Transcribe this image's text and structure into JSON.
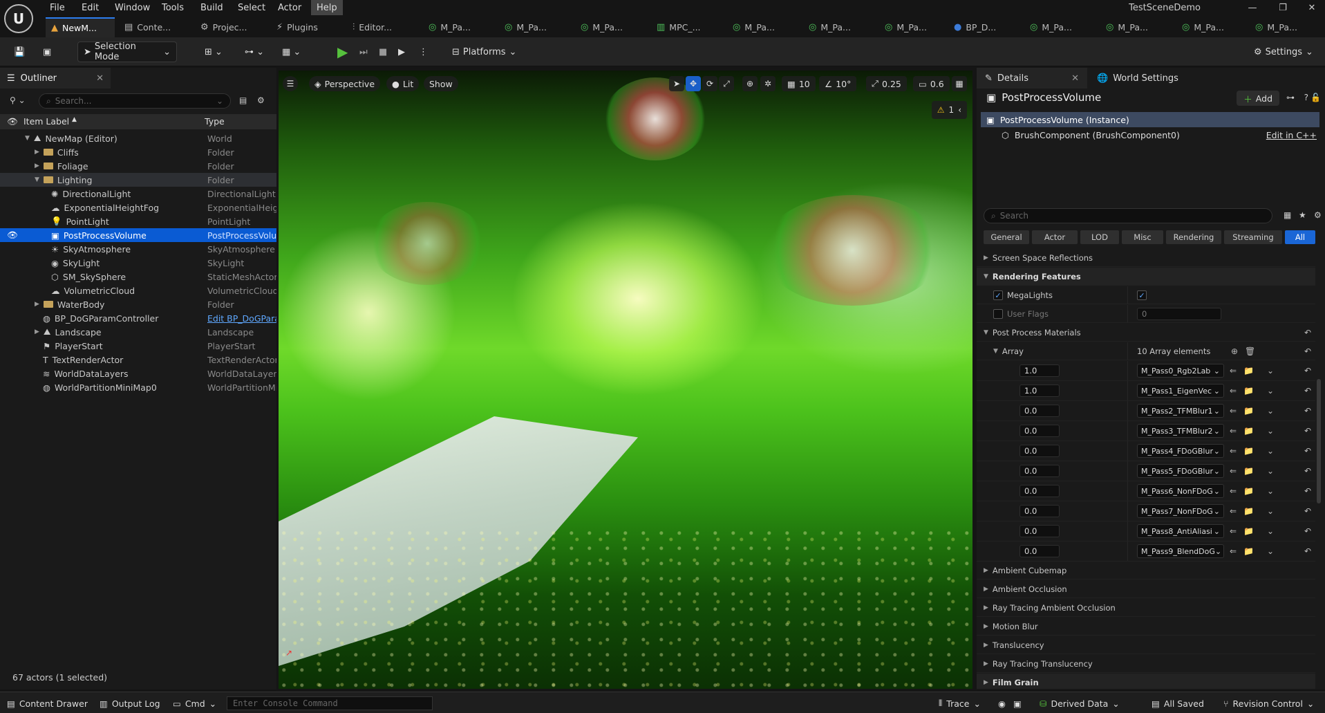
{
  "menu": [
    "File",
    "Edit",
    "Window",
    "Tools",
    "Build",
    "Select",
    "Actor",
    "Help"
  ],
  "project_title": "TestSceneDemo",
  "tabs": [
    {
      "label": "NewM..."
    },
    {
      "label": "Conte..."
    },
    {
      "label": "Projec..."
    },
    {
      "label": "Plugins"
    },
    {
      "label": "Editor..."
    },
    {
      "label": "M_Pa..."
    },
    {
      "label": "M_Pa..."
    },
    {
      "label": "M_Pa..."
    },
    {
      "label": "MPC_..."
    },
    {
      "label": "M_Pa..."
    },
    {
      "label": "M_Pa..."
    },
    {
      "label": "M_Pa..."
    },
    {
      "label": "BP_D..."
    },
    {
      "label": "M_Pa..."
    },
    {
      "label": "M_Pa..."
    },
    {
      "label": "M_Pa..."
    },
    {
      "label": "M_Pa..."
    }
  ],
  "toolbar": {
    "selection_mode": "Selection Mode",
    "platforms": "Platforms",
    "settings": "Settings"
  },
  "outliner": {
    "tab": "Outliner",
    "search_placeholder": "Search...",
    "col_label": "Item Label",
    "col_type": "Type",
    "footer": "67 actors (1 selected)",
    "rows": [
      {
        "label": "NewMap (Editor)",
        "type": "World"
      },
      {
        "label": "Cliffs",
        "type": "Folder"
      },
      {
        "label": "Foliage",
        "type": "Folder"
      },
      {
        "label": "Lighting",
        "type": "Folder"
      },
      {
        "label": "DirectionalLight",
        "type": "DirectionalLight"
      },
      {
        "label": "ExponentialHeightFog",
        "type": "ExponentialHeigh"
      },
      {
        "label": "PointLight",
        "type": "PointLight"
      },
      {
        "label": "PostProcessVolume",
        "type": "PostProcessVolu"
      },
      {
        "label": "SkyAtmosphere",
        "type": "SkyAtmosphere"
      },
      {
        "label": "SkyLight",
        "type": "SkyLight"
      },
      {
        "label": "SM_SkySphere",
        "type": "StaticMeshActor"
      },
      {
        "label": "VolumetricCloud",
        "type": "VolumetricCloud"
      },
      {
        "label": "WaterBody",
        "type": "Folder"
      },
      {
        "label": "BP_DoGParamController",
        "type": "Edit BP_DoGPara"
      },
      {
        "label": "Landscape",
        "type": "Landscape"
      },
      {
        "label": "PlayerStart",
        "type": "PlayerStart"
      },
      {
        "label": "TextRenderActor",
        "type": "TextRenderActor"
      },
      {
        "label": "WorldDataLayers",
        "type": "WorldDataLayers"
      },
      {
        "label": "WorldPartitionMiniMap0",
        "type": "WorldPartitionMi"
      }
    ]
  },
  "viewport": {
    "perspective": "Perspective",
    "lit": "Lit",
    "show": "Show",
    "grid": "10",
    "angle": "10°",
    "scale": "0.25",
    "camera": "0.6",
    "warnings": "1"
  },
  "details": {
    "tab": "Details",
    "world_settings": "World Settings",
    "actor": "PostProcessVolume",
    "add": "Add",
    "components": [
      {
        "label": "PostProcessVolume (Instance)"
      },
      {
        "label": "BrushComponent (BrushComponent0)",
        "action": "Edit in C++"
      }
    ],
    "search_placeholder": "Search",
    "categories": [
      "General",
      "Actor",
      "LOD",
      "Misc",
      "Rendering",
      "Streaming",
      "All"
    ],
    "ssr": "Screen Space Reflections",
    "rendering_features": "Rendering Features",
    "megalights": "MegaLights",
    "user_flags": "User Flags",
    "user_flags_value": "0",
    "ppm": "Post Process Materials",
    "array": "Array",
    "array_count": "10 Array elements",
    "elements": [
      {
        "weight": "1.0",
        "material": "M_Pass0_Rgb2Lab"
      },
      {
        "weight": "1.0",
        "material": "M_Pass1_EigenVec"
      },
      {
        "weight": "0.0",
        "material": "M_Pass2_TFMBlur1"
      },
      {
        "weight": "0.0",
        "material": "M_Pass3_TFMBlur2"
      },
      {
        "weight": "0.0",
        "material": "M_Pass4_FDoGBlur"
      },
      {
        "weight": "0.0",
        "material": "M_Pass5_FDoGBlur"
      },
      {
        "weight": "0.0",
        "material": "M_Pass6_NonFDoG"
      },
      {
        "weight": "0.0",
        "material": "M_Pass7_NonFDoG"
      },
      {
        "weight": "0.0",
        "material": "M_Pass8_AntiAliasi"
      },
      {
        "weight": "0.0",
        "material": "M_Pass9_BlendDoG"
      }
    ],
    "sections": [
      "Ambient Cubemap",
      "Ambient Occlusion",
      "Ray Tracing Ambient Occlusion",
      "Motion Blur",
      "Translucency",
      "Ray Tracing Translucency",
      "Film Grain"
    ]
  },
  "bottom": {
    "content_drawer": "Content Drawer",
    "output_log": "Output Log",
    "cmd": "Cmd",
    "console_placeholder": "Enter Console Command",
    "trace": "Trace",
    "derived_data": "Derived Data",
    "all_saved": "All Saved",
    "revision_control": "Revision Control"
  },
  "colors": {
    "accent": "#0a5bd3",
    "play": "#56c13d",
    "panel": "#1a1a1a"
  }
}
